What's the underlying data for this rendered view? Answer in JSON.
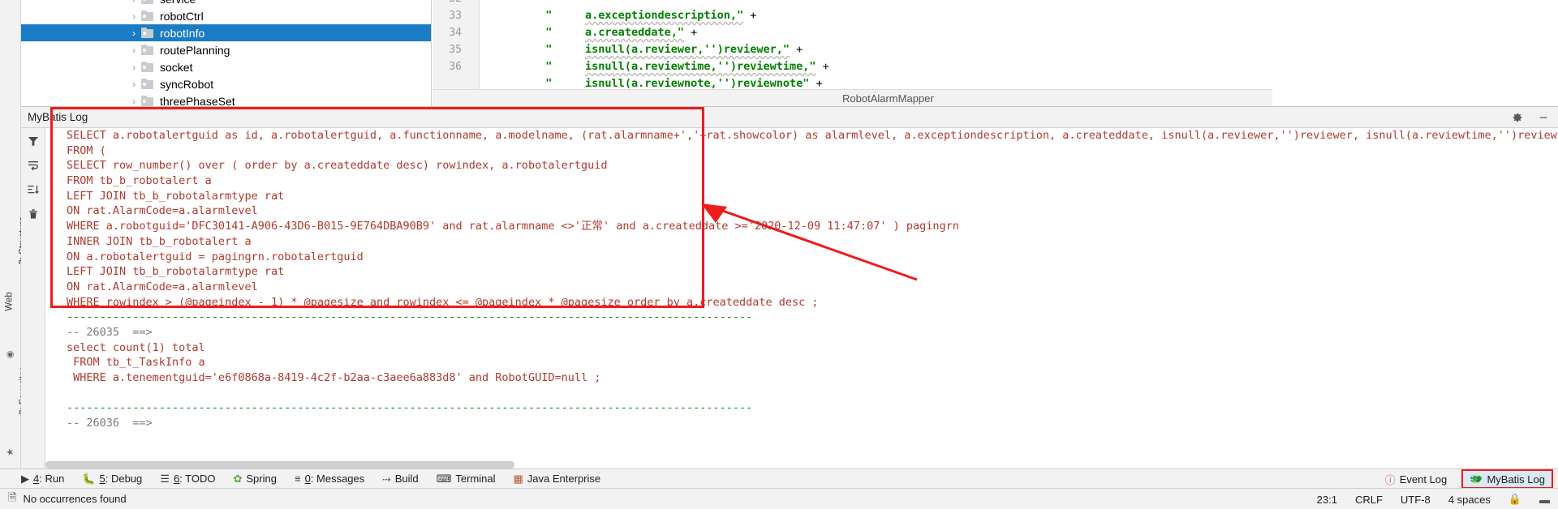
{
  "project_tree": {
    "items": [
      {
        "label": "service",
        "selected": false,
        "partial_top": true
      },
      {
        "label": "robotCtrl",
        "selected": false
      },
      {
        "label": "robotInfo",
        "selected": true
      },
      {
        "label": "routePlanning",
        "selected": false
      },
      {
        "label": "socket",
        "selected": false
      },
      {
        "label": "syncRobot",
        "selected": false
      },
      {
        "label": "threePhaseSet",
        "selected": false,
        "partial_bottom": true
      }
    ],
    "selection_color": "#1a7cc4"
  },
  "editor": {
    "breadcrumb": "RobotAlarmMapper",
    "lines": [
      {
        "number": "32",
        "quote": "\"",
        "code": "a.exceptiondescription,\"",
        "plus": "+",
        "partial": true
      },
      {
        "number": "33",
        "quote": "\"",
        "code": "a.createddate,\"",
        "plus": "+"
      },
      {
        "number": "34",
        "quote": "\"",
        "code": "isnull(a.reviewer,'')reviewer,\"",
        "plus": "+"
      },
      {
        "number": "35",
        "quote": "\"",
        "code": "isnull(a.reviewtime,'')reviewtime,\"",
        "plus": "+"
      },
      {
        "number": "36",
        "quote": "\"",
        "code": "isnull(a.reviewnote,'')reviewnote\"",
        "plus": "+"
      }
    ]
  },
  "tool_window": {
    "title": "MyBatis Log",
    "actions": [
      {
        "name": "settings",
        "icon": "gear-icon"
      },
      {
        "name": "hide",
        "icon": "minimize-icon"
      }
    ],
    "toolbar": [
      {
        "name": "filter",
        "icon": "filter-icon"
      },
      {
        "name": "soft-wrap",
        "icon": "wrap-icon"
      },
      {
        "name": "sort",
        "icon": "sort-icon"
      },
      {
        "name": "clear-all",
        "icon": "trash-icon"
      }
    ],
    "log_lines": [
      {
        "text": "SELECT a.robotalertguid as id, a.robotalertguid, a.functionname, a.modelname, (rat.alarmname+','+rat.showcolor) as alarmlevel, a.exceptiondescription, a.createddate, isnull(a.reviewer,'')reviewer, isnull(a.reviewtime,'')reviewtim",
        "style": "sql"
      },
      {
        "text": "FROM (",
        "style": "sql"
      },
      {
        "text": "SELECT row_number() over ( order by a.createddate desc) rowindex, a.robotalertguid",
        "style": "sql"
      },
      {
        "text": "FROM tb_b_robotalert a",
        "style": "sql"
      },
      {
        "text": "LEFT JOIN tb_b_robotalarmtype rat",
        "style": "sql"
      },
      {
        "text": "ON rat.AlarmCode=a.alarmlevel",
        "style": "sql"
      },
      {
        "text": "WHERE a.robotguid='DFC30141-A906-43D6-B015-9E764DBA90B9' and rat.alarmname <>'正常' and a.createddate >='2020-12-09 11:47:07' ) pagingrn",
        "style": "sql"
      },
      {
        "text": "INNER JOIN tb_b_robotalert a",
        "style": "sql"
      },
      {
        "text": "ON a.robotalertguid = pagingrn.robotalertguid",
        "style": "sql"
      },
      {
        "text": "LEFT JOIN tb_b_robotalarmtype rat",
        "style": "sql"
      },
      {
        "text": "ON rat.AlarmCode=a.alarmlevel",
        "style": "sql"
      },
      {
        "text": "WHERE rowindex > (@pageindex - 1) * @pagesize and rowindex <= @pageindex * @pagesize order by a.createddate desc ;",
        "style": "sql"
      },
      {
        "text": "--------------------------------------------------------------------------------------------------------",
        "style": "dash"
      },
      {
        "text": "-- 26035  ==>",
        "style": "gray"
      },
      {
        "text": "select count(1) total",
        "style": "sql"
      },
      {
        "text": " FROM tb_t_TaskInfo a",
        "style": "sql"
      },
      {
        "text": " WHERE a.tenementguid='e6f0868a-8419-4c2f-b2aa-c3aee6a883d8' and RobotGUID=null ;",
        "style": "sql"
      },
      {
        "text": "",
        "style": "sql"
      },
      {
        "text": "--------------------------------------------------------------------------------------------------------",
        "style": "dash"
      },
      {
        "text": "-- 26036  ==>",
        "style": "gray"
      }
    ],
    "annotation": {
      "color": "#ef1c1c",
      "shape": "rectangle-with-arrow"
    }
  },
  "left_strip": {
    "items": [
      {
        "label": "2: Structure",
        "name": "structure"
      },
      {
        "label": "Web",
        "name": "web"
      },
      {
        "label": "2: Favorites",
        "name": "favorites"
      }
    ]
  },
  "bottom_tabs": {
    "items": [
      {
        "key": "4",
        "label": ": Run",
        "icon": "run-icon",
        "name": "run"
      },
      {
        "key": "5",
        "label": ": Debug",
        "icon": "debug-icon",
        "name": "debug"
      },
      {
        "key": "6",
        "label": ": TODO",
        "icon": "todo-icon",
        "name": "todo"
      },
      {
        "key": "",
        "label": "Spring",
        "icon": "spring-icon",
        "name": "spring"
      },
      {
        "key": "0",
        "label": ": Messages",
        "icon": "messages-icon",
        "name": "messages"
      },
      {
        "key": "",
        "label": "Build",
        "icon": "build-icon",
        "name": "build"
      },
      {
        "key": "",
        "label": "Terminal",
        "icon": "terminal-icon",
        "name": "terminal"
      },
      {
        "key": "",
        "label": "Java Enterprise",
        "icon": "java-enterprise-icon",
        "name": "java-enterprise"
      }
    ],
    "event_log": "Event Log",
    "mybatis_log": "MyBatis Log"
  },
  "status_bar": {
    "message": "No occurrences found",
    "caret": "23:1",
    "line_separator": "CRLF",
    "encoding": "UTF-8",
    "indent": "4 spaces"
  }
}
